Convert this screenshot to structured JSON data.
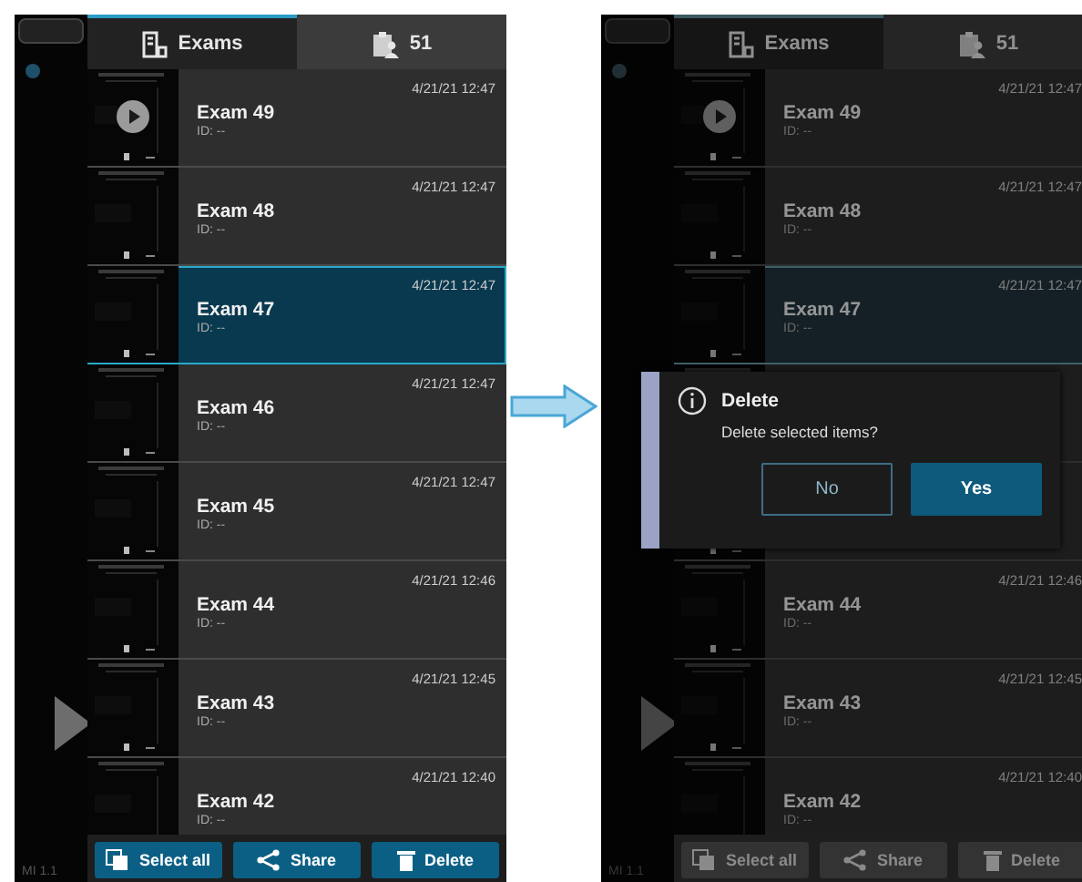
{
  "panels": [
    {
      "dimmed": false,
      "side_label": "MI 1.1",
      "tabs": [
        {
          "label": "Exams",
          "selected": true
        },
        {
          "label": "51",
          "selected": false
        }
      ],
      "rows": [
        {
          "name": "Exam 49",
          "id": "ID: --",
          "date": "4/21/21 12:47",
          "play": true,
          "selected": false
        },
        {
          "name": "Exam 48",
          "id": "ID: --",
          "date": "4/21/21 12:47",
          "play": false,
          "selected": false
        },
        {
          "name": "Exam 47",
          "id": "ID: --",
          "date": "4/21/21 12:47",
          "play": false,
          "selected": true
        },
        {
          "name": "Exam 46",
          "id": "ID: --",
          "date": "4/21/21 12:47",
          "play": false,
          "selected": false
        },
        {
          "name": "Exam 45",
          "id": "ID: --",
          "date": "4/21/21 12:47",
          "play": false,
          "selected": false
        },
        {
          "name": "Exam 44",
          "id": "ID: --",
          "date": "4/21/21 12:46",
          "play": false,
          "selected": false
        },
        {
          "name": "Exam 43",
          "id": "ID: --",
          "date": "4/21/21 12:45",
          "play": false,
          "selected": false
        },
        {
          "name": "Exam 42",
          "id": "ID: --",
          "date": "4/21/21 12:40",
          "play": false,
          "selected": false
        }
      ],
      "buttons": [
        {
          "label": "Select all",
          "disabled": false
        },
        {
          "label": "Share",
          "disabled": false
        },
        {
          "label": "Delete",
          "disabled": false
        }
      ]
    },
    {
      "dimmed": true,
      "side_label": "MI 1.1",
      "tabs": [
        {
          "label": "Exams",
          "selected": true
        },
        {
          "label": "51",
          "selected": false
        }
      ],
      "rows": [
        {
          "name": "Exam 49",
          "id": "ID: --",
          "date": "4/21/21 12:47",
          "play": true,
          "selected": false
        },
        {
          "name": "Exam 48",
          "id": "ID: --",
          "date": "4/21/21 12:47",
          "play": false,
          "selected": false
        },
        {
          "name": "Exam 47",
          "id": "ID: --",
          "date": "4/21/21 12:47",
          "play": false,
          "selected": true
        },
        {
          "selected": false
        },
        {
          "selected": false
        },
        {
          "name": "Exam 44",
          "id": "ID: --",
          "date": "4/21/21 12:46",
          "play": false,
          "selected": false
        },
        {
          "name": "Exam 43",
          "id": "ID: --",
          "date": "4/21/21 12:45",
          "play": false,
          "selected": false
        },
        {
          "name": "Exam 42",
          "id": "ID: --",
          "date": "4/21/21 12:40",
          "play": false,
          "selected": false
        }
      ],
      "buttons": [
        {
          "label": "Select all",
          "disabled": true
        },
        {
          "label": "Share",
          "disabled": true
        },
        {
          "label": "Delete",
          "disabled": true
        }
      ],
      "dialog": {
        "title": "Delete",
        "message": "Delete selected items?",
        "buttons": [
          {
            "label": "No",
            "kind": "secondary"
          },
          {
            "label": "Yes",
            "kind": "primary"
          }
        ]
      }
    }
  ]
}
